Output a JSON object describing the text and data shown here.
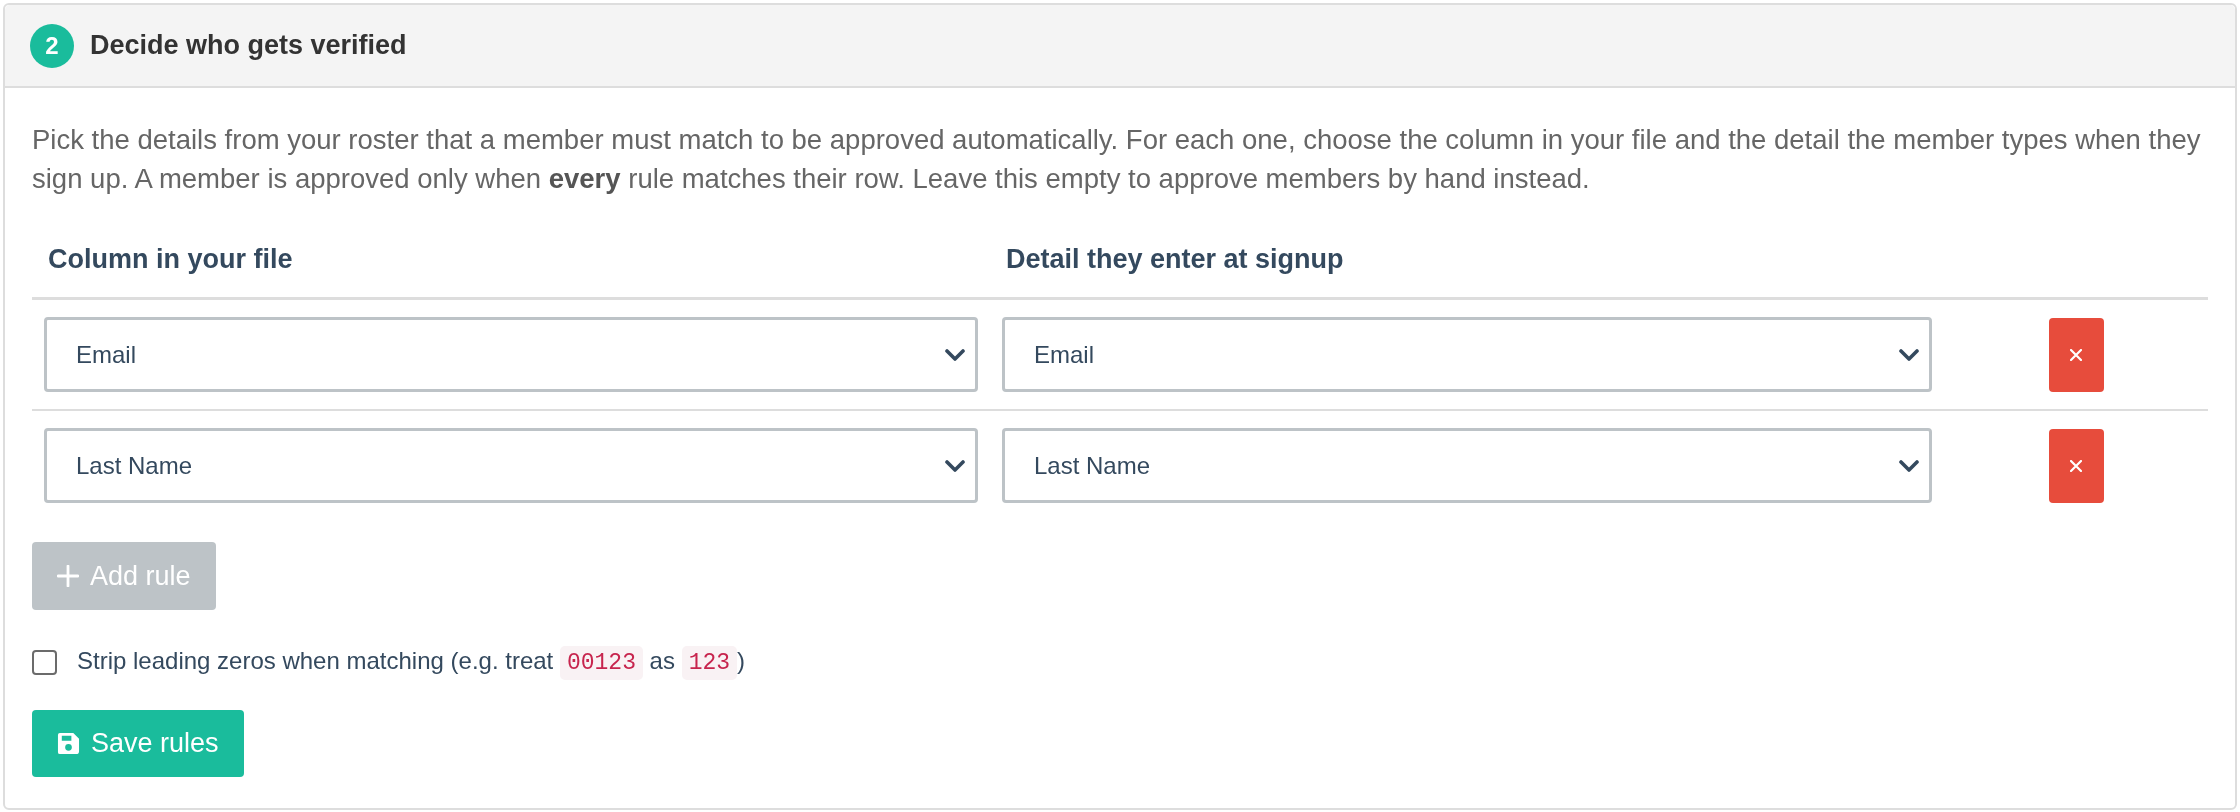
{
  "step": {
    "number": "2",
    "title": "Decide who gets verified"
  },
  "intro": "Pick the details from your roster that a member must match to be approved automatically. For each one, choose the column in your file and the detail the member types when they sign up. A member is approved only when **every** rule matches their row. Leave this empty to approve members by hand instead.",
  "rules_table": {
    "columns": [
      "Column in your file",
      "Detail they enter at signup"
    ],
    "rows": [
      {
        "file_column": "Email",
        "signup_detail": "Email"
      },
      {
        "file_column": "Last Name",
        "signup_detail": "Last Name"
      }
    ]
  },
  "add_button": {
    "label": "Add rule"
  },
  "strip_zeros": {
    "checked": false,
    "label_segments": [
      {
        "kind": "text",
        "text": "Strip leading zeros when matching (e.g. treat "
      },
      {
        "kind": "code",
        "text": "00123"
      },
      {
        "kind": "text",
        "text": " as "
      },
      {
        "kind": "code",
        "text": "123"
      },
      {
        "kind": "text",
        "text": ")"
      }
    ]
  },
  "save_button": {
    "label": "Save rules"
  }
}
